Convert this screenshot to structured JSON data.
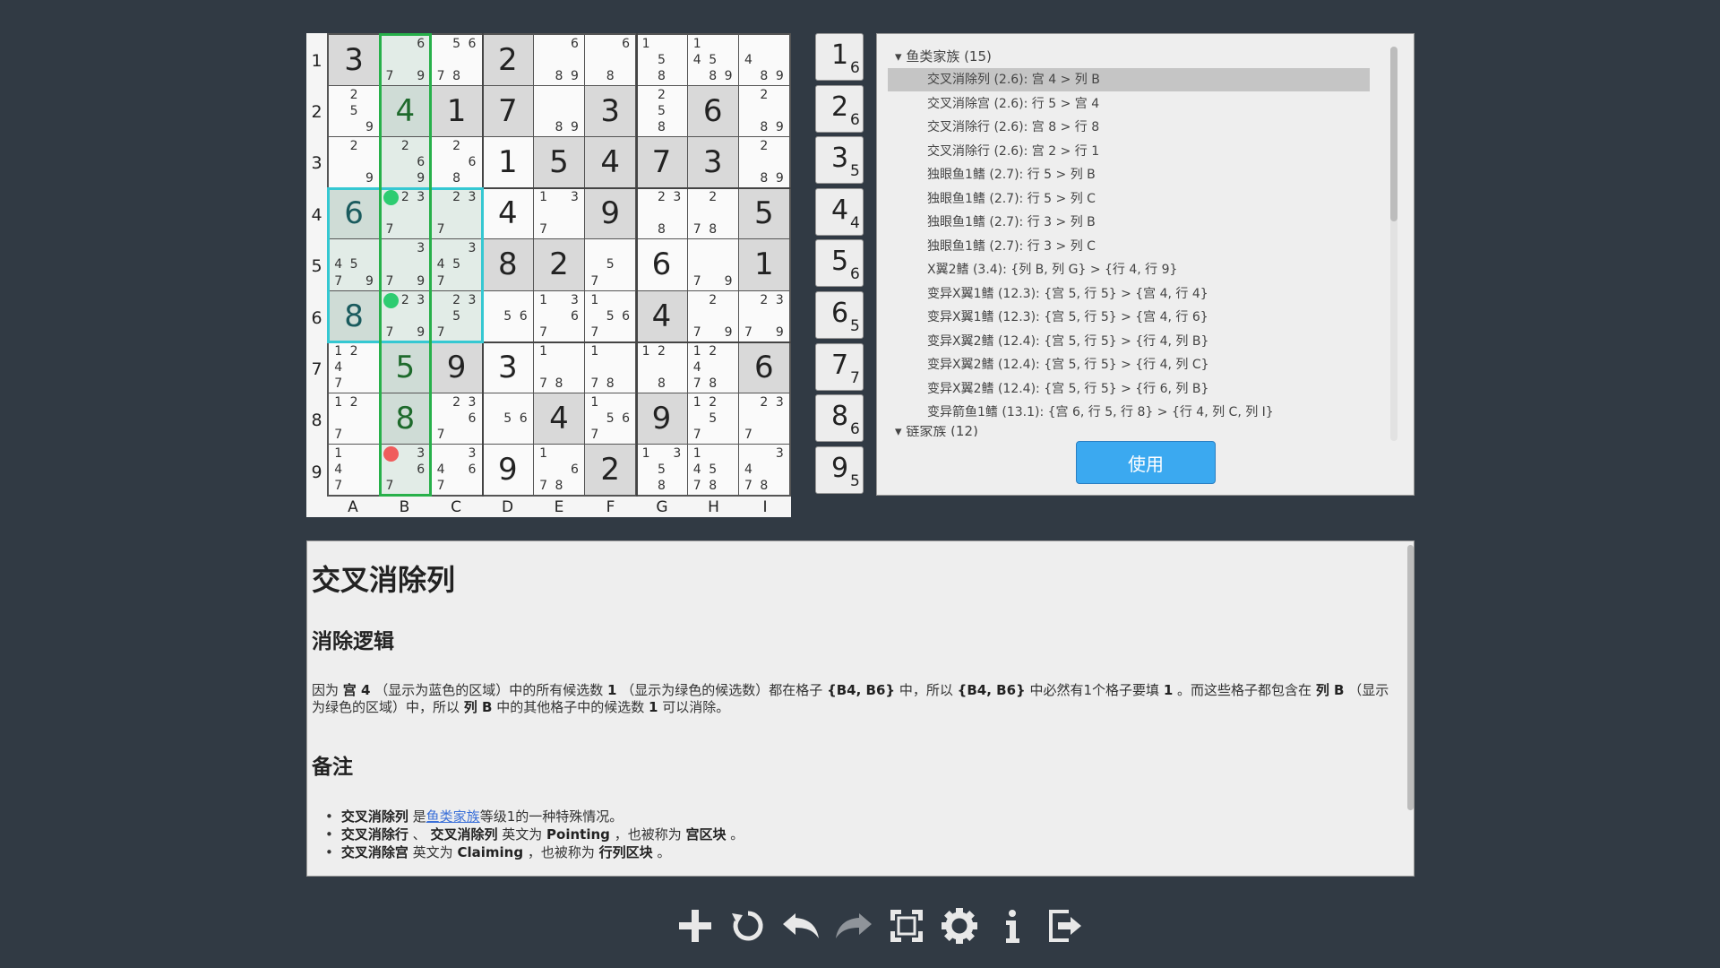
{
  "board": {
    "rows": [
      "1",
      "2",
      "3",
      "4",
      "5",
      "6",
      "7",
      "8",
      "9"
    ],
    "cols": [
      "A",
      "B",
      "C",
      "D",
      "E",
      "F",
      "G",
      "H",
      "I"
    ],
    "cells": [
      [
        {
          "v": "3",
          "s": "given"
        },
        {
          "c": [
            null,
            null,
            "6",
            "",
            "",
            "",
            "7",
            null,
            "9"
          ],
          "s": "tint"
        },
        {
          "c": [
            null,
            "5",
            "6",
            "",
            "",
            "",
            "7",
            "8",
            null
          ]
        },
        {
          "v": "2",
          "s": "given"
        },
        {
          "c": [
            null,
            null,
            "6",
            "",
            "",
            "",
            "",
            "8",
            "9"
          ]
        },
        {
          "c": [
            null,
            null,
            "6",
            "",
            "",
            "",
            "",
            "8",
            null
          ]
        },
        {
          "c": [
            "1",
            "",
            "",
            "",
            "5",
            "",
            "",
            "8",
            ""
          ]
        },
        {
          "c": [
            "1",
            "",
            "",
            "4",
            "5",
            "",
            "",
            "8",
            "9"
          ]
        },
        {
          "c": [
            "",
            "",
            "",
            "4",
            "",
            "",
            "",
            "8",
            "9"
          ]
        }
      ],
      [
        {
          "c": [
            "",
            "2",
            "",
            "",
            "5",
            "",
            "",
            "",
            "9"
          ]
        },
        {
          "v": "4",
          "s": "tintg",
          "g": true
        },
        {
          "v": "1",
          "s": "given"
        },
        {
          "v": "7",
          "s": "given"
        },
        {
          "c": [
            "",
            "",
            "",
            "",
            "",
            "",
            "",
            "8",
            "9"
          ]
        },
        {
          "v": "3",
          "s": "given"
        },
        {
          "c": [
            "",
            "2",
            "",
            "",
            "5",
            "",
            "",
            "8",
            ""
          ]
        },
        {
          "v": "6",
          "s": "given"
        },
        {
          "c": [
            "",
            "2",
            "",
            "",
            "",
            "",
            "",
            "8",
            "9"
          ]
        }
      ],
      [
        {
          "c": [
            "",
            "2",
            "",
            "",
            "",
            "",
            "",
            "",
            "9"
          ]
        },
        {
          "c": [
            "",
            "2",
            "",
            "",
            "",
            "6",
            "",
            "",
            "9"
          ],
          "s": "tint"
        },
        {
          "c": [
            "",
            "2",
            "",
            "",
            "",
            "6",
            "",
            "8",
            ""
          ]
        },
        {
          "v": "1"
        },
        {
          "v": "5",
          "s": "given"
        },
        {
          "v": "4",
          "s": "given"
        },
        {
          "v": "7",
          "s": "given"
        },
        {
          "v": "3",
          "s": "given"
        },
        {
          "c": [
            "",
            "2",
            "",
            "",
            "",
            "",
            "",
            "8",
            "9"
          ]
        }
      ],
      [
        {
          "v": "6",
          "s": "tintg",
          "t": true
        },
        {
          "c": [
            "1",
            "2",
            "3",
            "",
            "",
            "",
            "7",
            "",
            ""
          ],
          "s": "tint",
          "dot": "g"
        },
        {
          "c": [
            "",
            "2",
            "3",
            "",
            "",
            "",
            "7",
            "",
            ""
          ],
          "s": "tint"
        },
        {
          "v": "4"
        },
        {
          "c": [
            "1",
            "",
            "3",
            "",
            "",
            "",
            "7",
            "",
            ""
          ]
        },
        {
          "v": "9",
          "s": "given"
        },
        {
          "c": [
            "",
            "2",
            "3",
            "",
            "",
            "",
            "",
            "8",
            ""
          ]
        },
        {
          "c": [
            "",
            "2",
            "",
            "",
            "",
            "",
            "7",
            "8",
            ""
          ]
        },
        {
          "v": "5",
          "s": "given"
        }
      ],
      [
        {
          "c": [
            "",
            "",
            "",
            "4",
            "5",
            "",
            "7",
            "",
            "9"
          ],
          "s": "tint"
        },
        {
          "c": [
            "",
            "",
            "3",
            "",
            "",
            "",
            "7",
            "",
            "9"
          ],
          "s": "tint"
        },
        {
          "c": [
            "",
            "",
            "3",
            "4",
            "5",
            "",
            "7",
            "",
            ""
          ],
          "s": "tint"
        },
        {
          "v": "8",
          "s": "given"
        },
        {
          "v": "2",
          "s": "given"
        },
        {
          "c": [
            "",
            "",
            "",
            "",
            "5",
            "",
            "7",
            "",
            ""
          ]
        },
        {
          "v": "6"
        },
        {
          "c": [
            "",
            "",
            "",
            "",
            "",
            "",
            "7",
            "",
            "9"
          ]
        },
        {
          "v": "1",
          "s": "given"
        }
      ],
      [
        {
          "v": "8",
          "s": "tintg",
          "t": true
        },
        {
          "c": [
            "1",
            "2",
            "3",
            "",
            "",
            "",
            "7",
            "",
            "9"
          ],
          "s": "tint",
          "dot": "g"
        },
        {
          "c": [
            "",
            "2",
            "3",
            "",
            "5",
            "",
            "7",
            "",
            ""
          ],
          "s": "tint"
        },
        {
          "c": [
            "",
            "",
            "",
            "",
            "5",
            "6",
            "",
            "",
            ""
          ]
        },
        {
          "c": [
            "1",
            "",
            "3",
            "",
            "",
            "6",
            "7",
            "",
            ""
          ]
        },
        {
          "c": [
            "1",
            "",
            "",
            "",
            "5",
            "6",
            "7",
            "",
            ""
          ]
        },
        {
          "v": "4",
          "s": "given"
        },
        {
          "c": [
            "",
            "2",
            "",
            "",
            "",
            "",
            "7",
            "",
            "9"
          ]
        },
        {
          "c": [
            "",
            "2",
            "3",
            "",
            "",
            "",
            "7",
            "",
            "9"
          ]
        }
      ],
      [
        {
          "c": [
            "1",
            "2",
            "",
            "4",
            "",
            "",
            "7",
            "",
            ""
          ]
        },
        {
          "v": "5",
          "s": "tintg",
          "g": true
        },
        {
          "v": "9",
          "s": "given"
        },
        {
          "v": "3"
        },
        {
          "c": [
            "1",
            "",
            "",
            "",
            "",
            "",
            "7",
            "8",
            ""
          ]
        },
        {
          "c": [
            "1",
            "",
            "",
            "",
            "",
            "",
            "7",
            "8",
            ""
          ]
        },
        {
          "c": [
            "1",
            "2",
            "",
            "",
            "",
            "",
            "",
            "8",
            ""
          ]
        },
        {
          "c": [
            "1",
            "2",
            "",
            "4",
            "",
            "",
            "7",
            "8",
            ""
          ]
        },
        {
          "v": "6",
          "s": "given"
        }
      ],
      [
        {
          "c": [
            "1",
            "2",
            "",
            "",
            "",
            "",
            "7",
            "",
            ""
          ]
        },
        {
          "v": "8",
          "s": "tintg",
          "g": true
        },
        {
          "c": [
            "",
            "2",
            "3",
            "",
            "",
            "6",
            "7",
            "",
            ""
          ]
        },
        {
          "c": [
            "",
            "",
            "",
            "",
            "5",
            "6",
            "",
            "",
            ""
          ]
        },
        {
          "v": "4",
          "s": "given"
        },
        {
          "c": [
            "1",
            "",
            "",
            "",
            "5",
            "6",
            "7",
            "",
            ""
          ]
        },
        {
          "v": "9",
          "s": "given"
        },
        {
          "c": [
            "1",
            "2",
            "",
            "",
            "5",
            "",
            "7",
            "",
            ""
          ]
        },
        {
          "c": [
            "",
            "2",
            "3",
            "",
            "",
            "",
            "7",
            "",
            ""
          ]
        }
      ],
      [
        {
          "c": [
            "1",
            "",
            "",
            "4",
            "",
            "",
            "7",
            "",
            ""
          ]
        },
        {
          "c": [
            "1",
            "",
            "3",
            "",
            "",
            "6",
            "7",
            "",
            ""
          ],
          "s": "tint",
          "dot": "r"
        },
        {
          "c": [
            "",
            "",
            "3",
            "4",
            "",
            "6",
            "7",
            "",
            ""
          ]
        },
        {
          "v": "9"
        },
        {
          "c": [
            "1",
            "",
            "",
            "",
            "",
            "6",
            "7",
            "8",
            ""
          ]
        },
        {
          "v": "2",
          "s": "given"
        },
        {
          "c": [
            "1",
            "",
            "3",
            "",
            "5",
            "",
            "",
            "8",
            ""
          ]
        },
        {
          "c": [
            "1",
            "",
            "",
            "4",
            "5",
            "",
            "7",
            "8",
            ""
          ]
        },
        {
          "c": [
            "",
            "",
            "3",
            "4",
            "",
            "",
            "7",
            "8",
            ""
          ]
        }
      ]
    ]
  },
  "numbers": [
    {
      "n": "1",
      "c": "6"
    },
    {
      "n": "2",
      "c": "6"
    },
    {
      "n": "3",
      "c": "5"
    },
    {
      "n": "4",
      "c": "4"
    },
    {
      "n": "5",
      "c": "6"
    },
    {
      "n": "6",
      "c": "5"
    },
    {
      "n": "7",
      "c": "7"
    },
    {
      "n": "8",
      "c": "6"
    },
    {
      "n": "9",
      "c": "5"
    }
  ],
  "techniques": {
    "group1": "鱼类家族 (15)",
    "items": [
      "交叉消除列 (2.6): 宫 4 > 列 B",
      "交叉消除宫 (2.6): 行 5 > 宫 4",
      "交叉消除行 (2.6): 宫 8 > 行 8",
      "交叉消除行 (2.6): 宫 2 > 行 1",
      "独眼鱼1鳍 (2.7): 行 5 > 列 B",
      "独眼鱼1鳍 (2.7): 行 5 > 列 C",
      "独眼鱼1鳍 (2.7): 行 3 > 列 B",
      "独眼鱼1鳍 (2.7): 行 3 > 列 C",
      "X翼2鳍 (3.4): {列 B, 列 G} > {行 4, 行 9}",
      "变异X翼1鳍 (12.3): {宫 5, 行 5} > {宫 4, 行 4}",
      "变异X翼1鳍 (12.3): {宫 5, 行 5} > {宫 4, 行 6}",
      "变异X翼2鳍 (12.4): {宫 5, 行 5} > {行 4, 列 B}",
      "变异X翼2鳍 (12.4): {宫 5, 行 5} > {行 4, 列 C}",
      "变异X翼2鳍 (12.4): {宫 5, 行 5} > {行 6, 列 B}",
      "变异箭鱼1鳍 (13.1): {宫 6, 行 5, 行 8} > {行 4, 列 C, 列 I}"
    ],
    "group2": "链家族 (12)",
    "apply": "使用"
  },
  "explain": {
    "title": "交叉消除列",
    "h_logic": "消除逻辑",
    "p1": "因为",
    "p_box4": "宫 4",
    "p2": "（显示为蓝色的区域）中的所有候选数",
    "p_one": "1",
    "p3": "（显示为绿色的候选数）都在格子",
    "p_cells": "{B4, B6}",
    "p4": "中，所以",
    "p_cells2": "{B4, B6}",
    "p5": "中必然有1个格子要填",
    "p_one2": "1",
    "p6": "。而这些格子都包含在",
    "p_colb": "列 B",
    "p7": "（显示为绿色的区域）中，所以",
    "p_colb2": "列 B",
    "p8": "中的其他格子中的候选数",
    "p_one3": "1",
    "p9": "可以消除。",
    "h_notes": "备注",
    "n1a": "交叉消除列",
    "n1b": "是",
    "n1link": "鱼类家族",
    "n1c": "等级1的一种特殊情况。",
    "n2a": "交叉消除行",
    "n2b": "、",
    "n2c": "交叉消除列",
    "n2d": "英文为",
    "n2e": "Pointing",
    "n2f": "，也被称为",
    "n2g": "宫区块",
    "n2h": "。",
    "n3a": "交叉消除宫",
    "n3b": "英文为",
    "n3c": "Claiming",
    "n3d": "，也被称为",
    "n3e": "行列区块",
    "n3f": "。"
  },
  "toolbar": [
    "plus-icon",
    "reset-icon",
    "undo-icon",
    "redo-icon",
    "fullscreen-icon",
    "settings-icon",
    "info-icon",
    "exit-icon"
  ]
}
